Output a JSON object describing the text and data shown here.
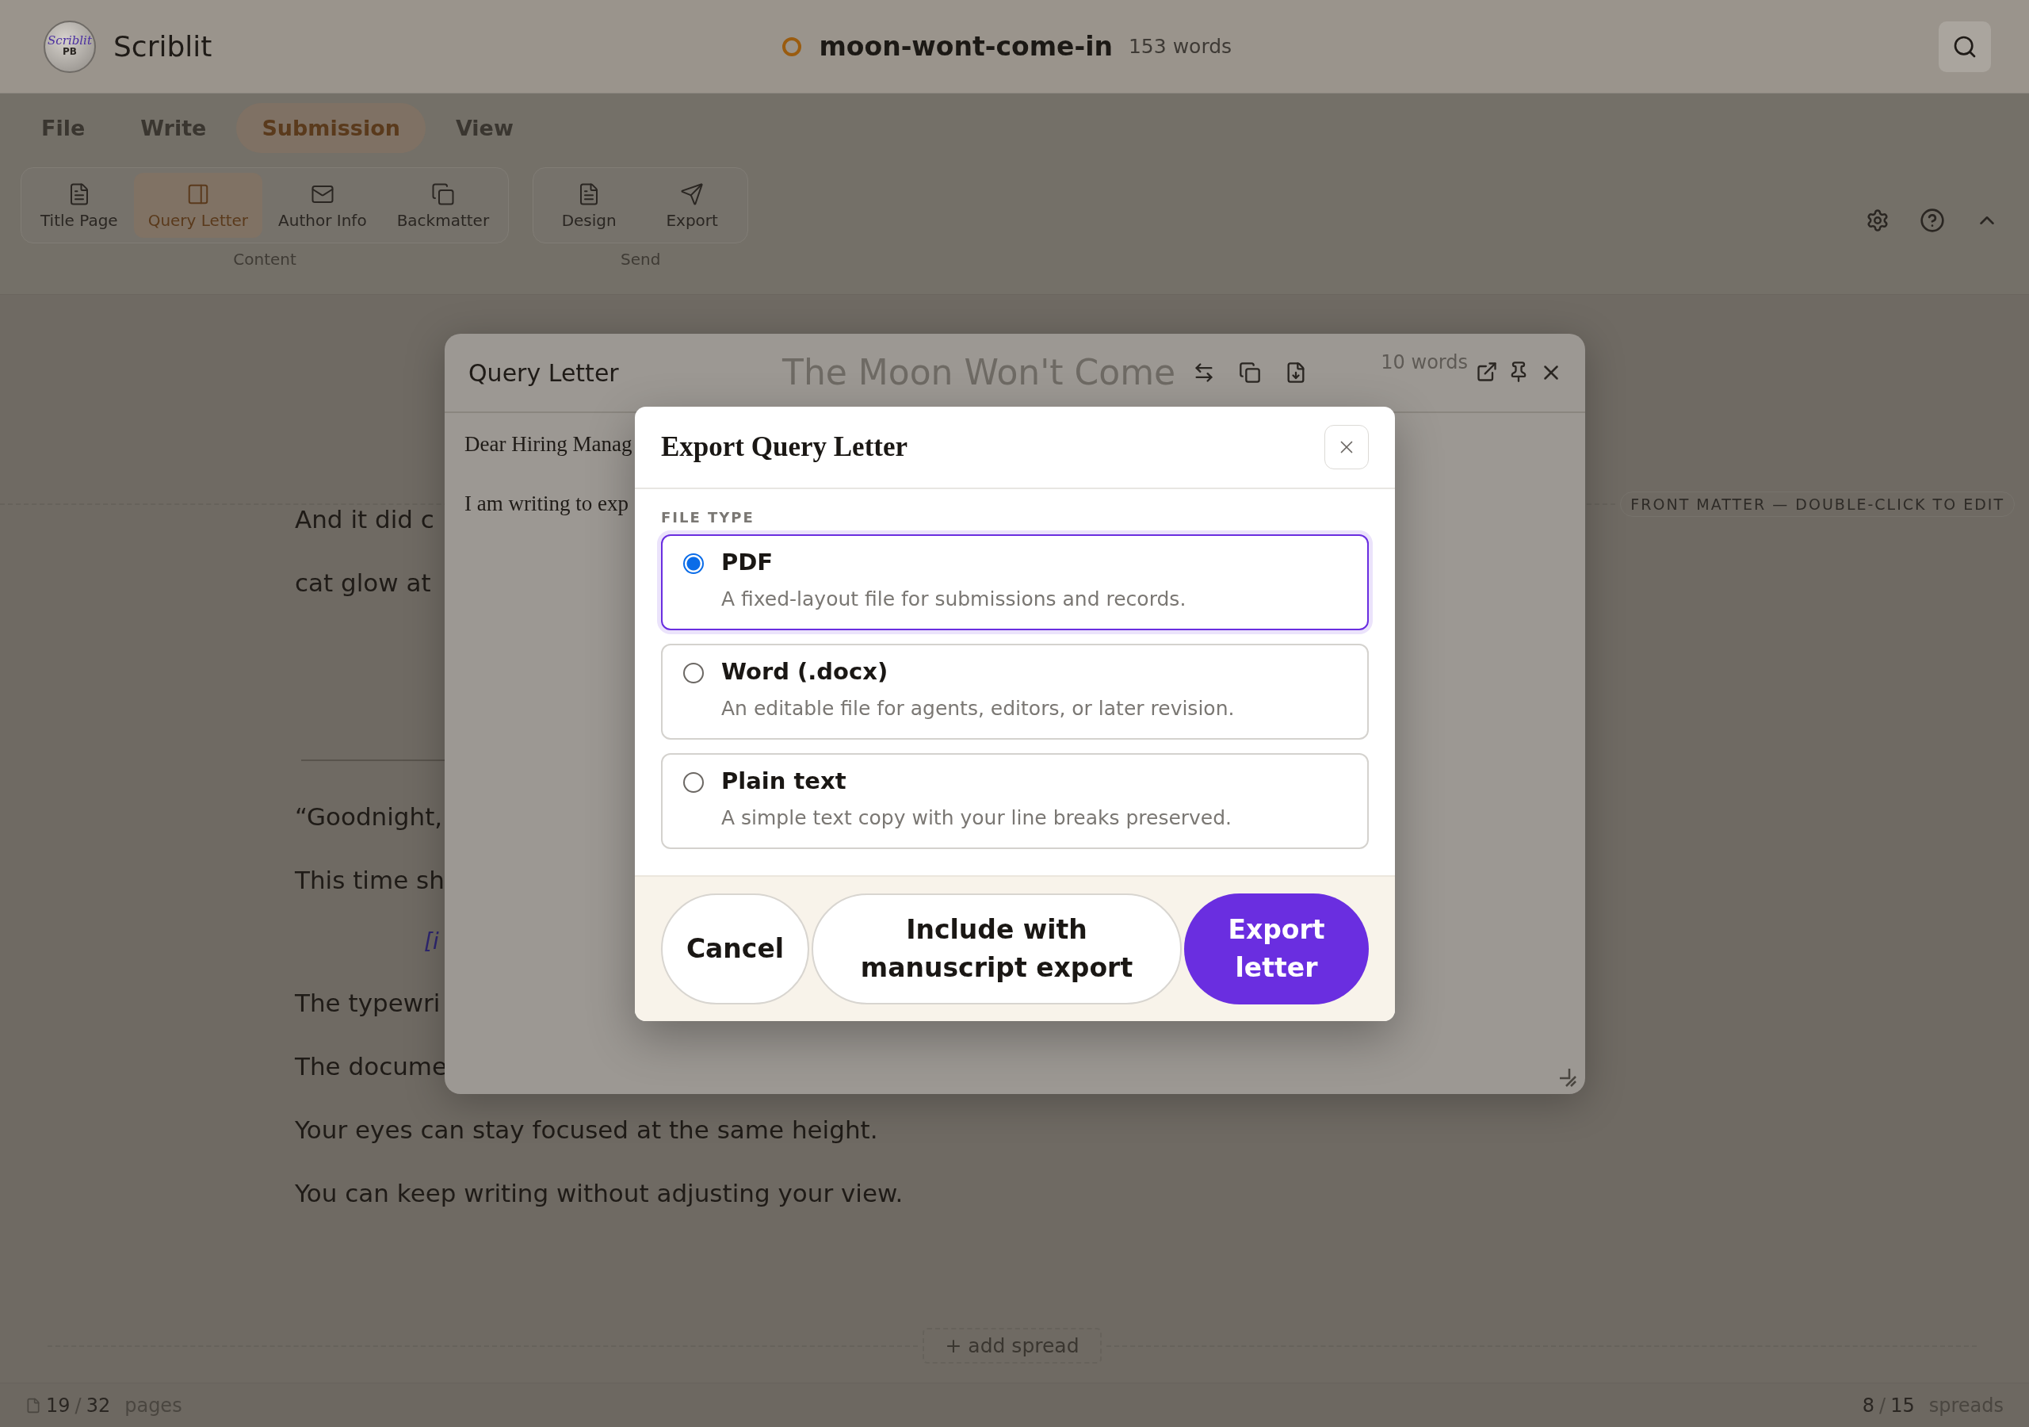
{
  "app": {
    "name": "Scriblit",
    "logo": {
      "script": "Scriblit",
      "badge": "PB"
    }
  },
  "document": {
    "title": "moon-wont-come-in",
    "word_count": "153 words"
  },
  "menu_tabs": [
    {
      "label": "File",
      "selected": false
    },
    {
      "label": "Write",
      "selected": false
    },
    {
      "label": "Submission",
      "selected": true
    },
    {
      "label": "View",
      "selected": false
    }
  ],
  "ribbon_groups": [
    {
      "label": "Content",
      "items": [
        {
          "label": "Title Page",
          "selected": false
        },
        {
          "label": "Query Letter",
          "selected": true
        },
        {
          "label": "Author Info",
          "selected": false
        },
        {
          "label": "Backmatter",
          "selected": false
        }
      ]
    },
    {
      "label": "Send",
      "items": [
        {
          "label": "Design",
          "selected": false
        },
        {
          "label": "Export",
          "selected": false
        }
      ]
    }
  ],
  "front_matter_label": "FRONT MATTER — DOUBLE-CLICK TO EDIT",
  "story": [
    {
      "kind": "line",
      "text": "And it did c"
    },
    {
      "kind": "line",
      "text": "cat glow at"
    },
    {
      "kind": "rule"
    },
    {
      "kind": "line",
      "text": "“Goodnight,"
    },
    {
      "kind": "line",
      "text": "This time sh"
    },
    {
      "kind": "note",
      "text": "[i"
    },
    {
      "kind": "line",
      "text": "The typewri"
    },
    {
      "kind": "line",
      "text": "The docume"
    },
    {
      "kind": "line",
      "text": "Your eyes can stay focused at the same height."
    },
    {
      "kind": "line",
      "text": "You can keep writing without adjusting your view."
    }
  ],
  "query_panel": {
    "title": "Query Letter",
    "backdrop_title": "The Moon Won't Come",
    "word_count": "10 words",
    "lines": [
      "Dear Hiring Manag",
      "I am writing to exp"
    ]
  },
  "export_dialog": {
    "title": "Export Query Letter",
    "section_label": "FILE TYPE",
    "options": [
      {
        "label": "PDF",
        "description": "A fixed-layout file for submissions and records.",
        "selected": true
      },
      {
        "label": "Word (.docx)",
        "description": "An editable file for agents, editors, or later revision.",
        "selected": false
      },
      {
        "label": "Plain text",
        "description": "A simple text copy with your line breaks preserved.",
        "selected": false
      }
    ],
    "buttons": [
      {
        "label": "Cancel",
        "kind": "secondary"
      },
      {
        "label": "Include with manuscript export",
        "kind": "secondary"
      },
      {
        "label": "Export letter",
        "kind": "primary"
      }
    ]
  },
  "add_spread": "+ add spread",
  "status_bar": {
    "pages": {
      "current": "19",
      "separator": "/",
      "total": "32",
      "label": "pages"
    },
    "spreads": {
      "current": "8",
      "separator": "/",
      "total": "15",
      "label": "spreads"
    }
  }
}
